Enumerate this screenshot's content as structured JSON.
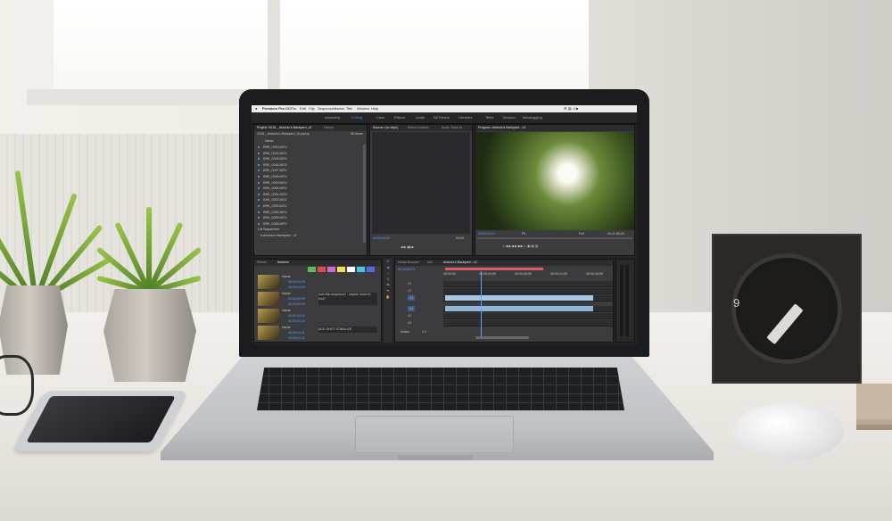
{
  "app": {
    "name": "Premiere Pro CC",
    "menu": [
      "File",
      "Edit",
      "Clip",
      "Sequence",
      "Marker",
      "Title",
      "Window",
      "Help"
    ],
    "workspaces": [
      "Assembly",
      "Editing",
      "Color",
      "Effects",
      "Audio",
      "All Panels",
      "Libraries",
      "Titles",
      "Docked",
      "Metalogging"
    ],
    "active_workspace": "Editing"
  },
  "project_panel": {
    "tabs": [
      "Project: 2018 _ Antonio's Backyard_v2",
      "History"
    ],
    "path": "2018 _ Antonio's Backyard_v2.prproj",
    "item_count": "36 Items",
    "column_header": "Name",
    "items": [
      "BRK_0043.MOV",
      "BRK_0044.MOV",
      "BRK_0045.MOV",
      "BRK_0046.MOV",
      "BRK_0047.MOV",
      "BRK_0048.MOV",
      "BRK_0049.MOV",
      "BRK_0050.MOV",
      "BRK_0051.MOV",
      "BRK_0052.MOV",
      "BRK_0053.MOV",
      "BRK_0054.MOV",
      "BRK_0055.MOV",
      "BRK_0056.MOV",
      "Sequences",
      "Antonio's Backyard - v2"
    ]
  },
  "source_panel": {
    "tabs": [
      "Source: (no clips)",
      "Effect Controls",
      "Audio Track M"
    ],
    "timecode_left": "00;00;00;00",
    "timecode_right": "00;00"
  },
  "program_panel": {
    "tabs": [
      "Program: Antonio's Backyard - v2"
    ],
    "timecode": "00;00;20;01",
    "duration": "00;11;59;20",
    "zoom": "Fit",
    "quality": "Full"
  },
  "markers_panel": {
    "tabs": [
      "Effects",
      "Markers"
    ],
    "swatch_colors": [
      "#5dbb5d",
      "#e04a4a",
      "#d465d4",
      "#f2e04a",
      "#ffffff",
      "#4ac6e0",
      "#4a6ee0"
    ],
    "entries": [
      {
        "name": "Name",
        "in": "00;00;01;20",
        "out": "00;00;01;20",
        "comment": ""
      },
      {
        "name": "Name",
        "in": "00;00;02;09",
        "out": "00;00;02;09",
        "comment": "love this sequence! - maybe move to end?"
      },
      {
        "name": "Name",
        "in": "00;00;03;10",
        "out": "00;00;03;10",
        "comment": ""
      },
      {
        "name": "Name",
        "in": "00;00;04;11",
        "out": "00;00;04;11",
        "comment": "ADD SHOT STABILIZE"
      }
    ]
  },
  "timeline_panel": {
    "tabs": [
      "Media Browser",
      "Info",
      "Antonio's Backyard - v2"
    ],
    "timecode": "00;00;05;23",
    "ruler": [
      "00;00;00",
      "00;00;04;00",
      "00;00;08;00",
      "00;00;12;00",
      "00;00;16;00"
    ],
    "video_tracks": [
      "V3",
      "V2",
      "V1"
    ],
    "audio_tracks": [
      "A1",
      "A2",
      "A3"
    ],
    "master_label": "Master",
    "master_value": "0.0"
  },
  "colors": {
    "accent_blue": "#4a8fe0",
    "work_area": "#e05a6a",
    "clip_video": "#a8c8e8",
    "clip_audio": "#8fb5d9"
  }
}
